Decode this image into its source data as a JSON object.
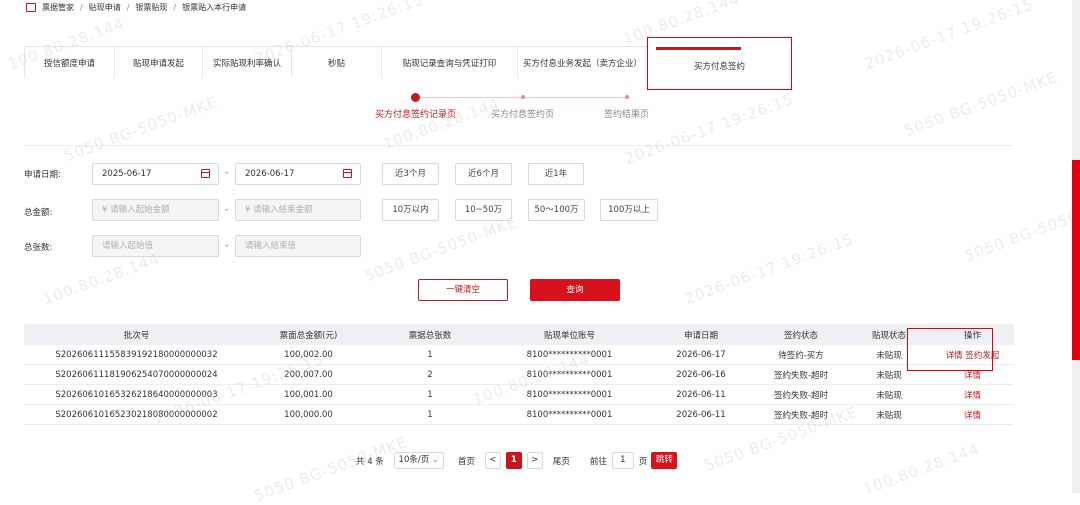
{
  "breadcrumb": {
    "items": [
      "票据管家",
      "贴现申请",
      "银票贴现",
      "银票贴入本行申请"
    ],
    "separator": "/"
  },
  "tabs": [
    {
      "label": "授信额度申请",
      "active": false
    },
    {
      "label": "贴现申请发起",
      "active": false
    },
    {
      "label": "实际贴现利率确认",
      "active": false
    },
    {
      "label": "秒贴",
      "active": false
    },
    {
      "label": "贴现记录查询与凭证打印",
      "active": false
    },
    {
      "label": "买方付息业务发起（卖方企业）",
      "active": false
    },
    {
      "label": "买方付息签约",
      "active": true
    }
  ],
  "steps": [
    {
      "label": "买方付息签约记录页",
      "active": true
    },
    {
      "label": "买方付息签约页",
      "active": false
    },
    {
      "label": "签约结果页",
      "active": false
    }
  ],
  "filters": {
    "date": {
      "label": "申请日期:",
      "start": "2025-06-17",
      "end": "2026-06-17",
      "separator": "-",
      "quick": [
        "近3个月",
        "近6个月",
        "近1年"
      ]
    },
    "amount": {
      "label": "总金额:",
      "start_placeholder": "¥  请输入起始金额",
      "end_placeholder": "¥  请输入结束金额",
      "separator": "-",
      "quick": [
        "10万以内",
        "10~50万",
        "50～100万",
        "100万以上"
      ]
    },
    "count": {
      "label": "总张数:",
      "start_placeholder": "请输入起始值",
      "end_placeholder": "请输入结束值",
      "separator": "-"
    }
  },
  "actions": {
    "clear_label": "一键清空",
    "query_label": "查询"
  },
  "table": {
    "columns": [
      "批次号",
      "票面总金额(元)",
      "票据总张数",
      "贴现单位账号",
      "申请日期",
      "签约状态",
      "贴现状态",
      "操作"
    ],
    "rows": [
      {
        "batch": "S20260611155839192180000000032",
        "amount": "100,002.00",
        "count": "1",
        "account": "8100**********0001",
        "date": "2026-06-17",
        "sign_status": "待签约-买方",
        "discount_status": "未贴现",
        "ops": [
          "详情",
          "签约发起"
        ]
      },
      {
        "batch": "S20260611181906254070000000024",
        "amount": "200,007.00",
        "count": "2",
        "account": "8100**********0001",
        "date": "2026-06-16",
        "sign_status": "签约失败-超时",
        "discount_status": "未贴现",
        "ops": [
          "详情"
        ]
      },
      {
        "batch": "S20260610165326218640000000003",
        "amount": "100,001.00",
        "count": "1",
        "account": "8100**********0001",
        "date": "2026-06-11",
        "sign_status": "签约失败-超时",
        "discount_status": "未贴现",
        "ops": [
          "详情"
        ]
      },
      {
        "batch": "S20260610165230218080000000002",
        "amount": "100,000.00",
        "count": "1",
        "account": "8100**********0001",
        "date": "2026-06-11",
        "sign_status": "签约失败-超时",
        "discount_status": "未贴现",
        "ops": [
          "详情"
        ]
      }
    ]
  },
  "pagination": {
    "total": "共 4 条",
    "page_size": "10条/页",
    "first": "首页",
    "prev": "<",
    "current": "1",
    "next": ">",
    "last": "尾页",
    "goto_label": "前往",
    "goto_value": "1",
    "page_unit": "页",
    "jump_label": "跳转"
  },
  "watermark": {
    "lines": [
      "5050  BG-5050-MKE",
      "100.80.28.144",
      "2026-06-17  19:26:15"
    ]
  },
  "colors": {
    "accent": "#c8161d",
    "highlight_border": "#e00010",
    "header_bg": "#eef0f4"
  }
}
